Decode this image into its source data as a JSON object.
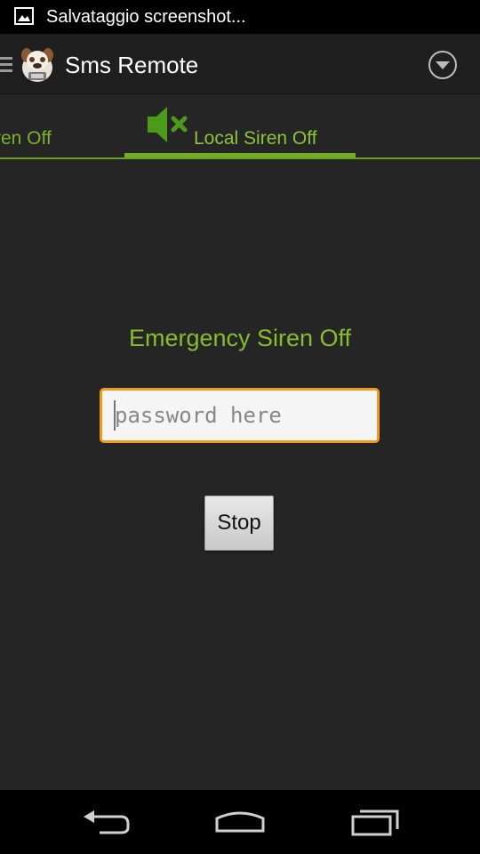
{
  "status_bar": {
    "notification_text": "Salvataggio screenshot...",
    "icon": "image-icon"
  },
  "action_bar": {
    "title": "Sms Remote",
    "logo": "bulldog-logo-icon",
    "overflow_icon": "chevron-down-circle-icon"
  },
  "tabs": {
    "previous_tab_label": "ren Off",
    "active_tab_label": "Local Siren Off",
    "active_tab_icon": "speaker-muted-icon"
  },
  "main": {
    "heading": "Emergency Siren Off",
    "password_placeholder": "password here",
    "password_value": "",
    "stop_label": "Stop"
  },
  "colors": {
    "accent_green": "#86bd2c",
    "input_focus_orange": "#f29a1e",
    "background": "#252525"
  },
  "nav_bar": {
    "back_icon": "back-icon",
    "home_icon": "home-icon",
    "recent_icon": "recent-apps-icon"
  }
}
